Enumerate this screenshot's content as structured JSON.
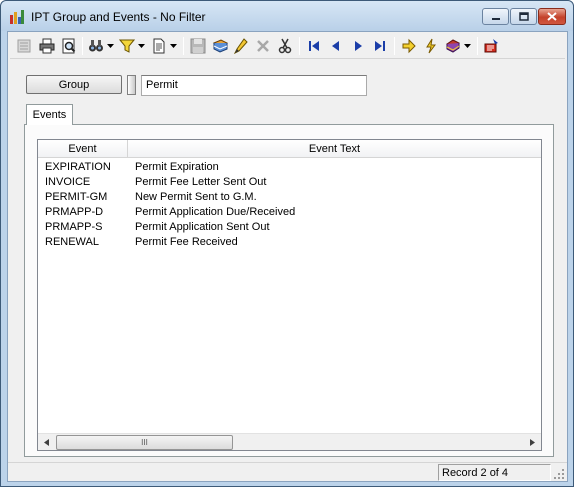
{
  "window": {
    "title": "IPT Group and Events - No Filter"
  },
  "toolbar": {
    "icons": [
      "list-view-icon",
      "print-icon",
      "print-preview-icon",
      "search-binoculars-icon",
      "filter-icon",
      "report-icon",
      "save-icon",
      "notebook-icon",
      "edit-pencil-icon",
      "delete-icon",
      "cut-icon",
      "first-record-icon",
      "previous-record-icon",
      "next-record-icon",
      "last-record-icon",
      "go-arrow-icon",
      "lightning-icon",
      "books-icon",
      "exit-icon"
    ]
  },
  "group": {
    "button_label": "Group",
    "value": "Permit"
  },
  "tabs": [
    {
      "label": "Events"
    }
  ],
  "grid": {
    "columns": [
      "Event",
      "Event Text"
    ],
    "rows": [
      {
        "event": "EXPIRATION",
        "text": "Permit Expiration"
      },
      {
        "event": "INVOICE",
        "text": "Permit Fee Letter Sent Out"
      },
      {
        "event": "PERMIT-GM",
        "text": "New Permit Sent to G.M."
      },
      {
        "event": "PRMAPP-D",
        "text": "Permit Application Due/Received"
      },
      {
        "event": "PRMAPP-S",
        "text": "Permit Application Sent Out"
      },
      {
        "event": "RENEWAL",
        "text": "Permit Fee Received"
      }
    ],
    "scroll_thumb_label": "III"
  },
  "status": {
    "record": "Record 2 of 4"
  }
}
